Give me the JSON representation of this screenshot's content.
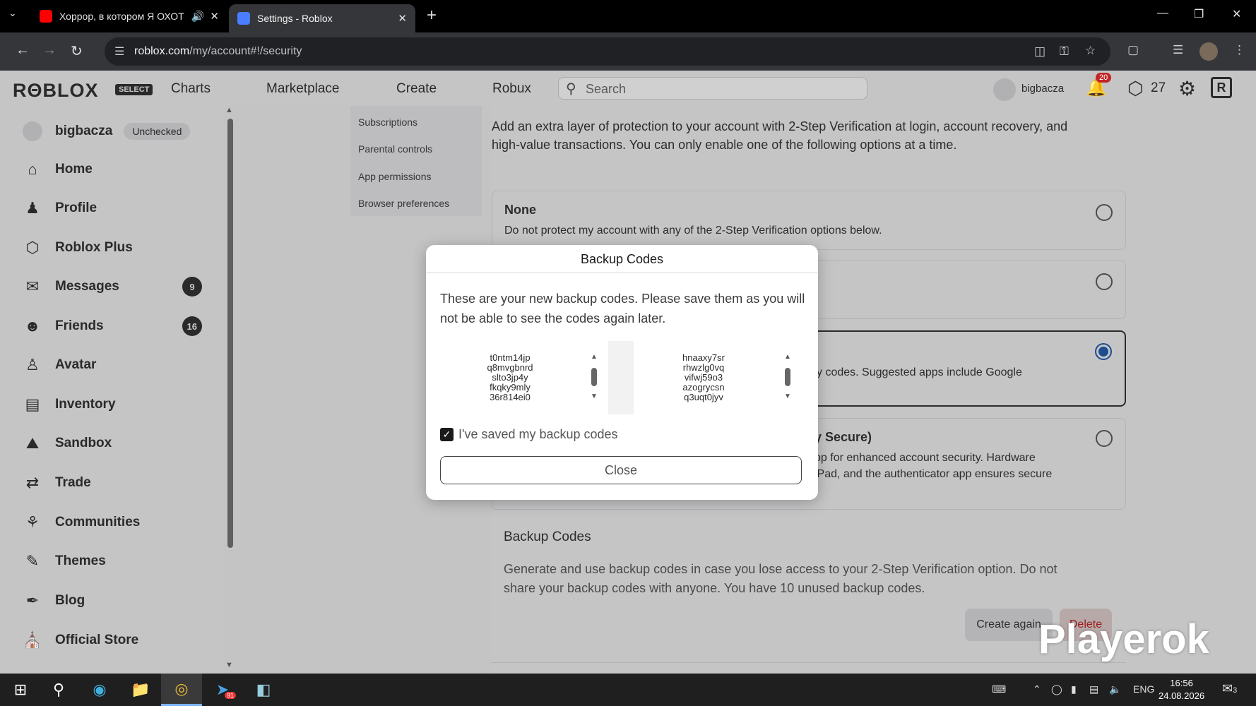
{
  "browser": {
    "tabs": [
      {
        "title": "Хоррор, в котором Я ОХОТ",
        "icon": "youtube-icon",
        "color": "#ff0000"
      },
      {
        "title": "Settings - Roblox",
        "icon": "roblox-icon",
        "color": "#4a7dff"
      }
    ],
    "url_host": "roblox.com",
    "url_path": "/my/account#!/security"
  },
  "roblox_header": {
    "logo": "RΘBLOX",
    "logo_badge": "SELECT",
    "nav": [
      "Charts",
      "Marketplace",
      "Create",
      "Robux"
    ],
    "search_placeholder": "Search",
    "username": "bigbacza",
    "notifications": "20",
    "robux": "27"
  },
  "sidebar": {
    "username": "bigbacza",
    "status": "Unchecked",
    "items": [
      {
        "label": "Home",
        "icon": "home-icon",
        "badge": ""
      },
      {
        "label": "Profile",
        "icon": "profile-icon",
        "badge": ""
      },
      {
        "label": "Roblox Plus",
        "icon": "roblox-plus-icon",
        "badge": ""
      },
      {
        "label": "Messages",
        "icon": "messages-icon",
        "badge": "9"
      },
      {
        "label": "Friends",
        "icon": "friends-icon",
        "badge": "16"
      },
      {
        "label": "Avatar",
        "icon": "avatar-icon",
        "badge": ""
      },
      {
        "label": "Inventory",
        "icon": "inventory-icon",
        "badge": ""
      },
      {
        "label": "Sandbox",
        "icon": "sandbox-icon",
        "badge": ""
      },
      {
        "label": "Trade",
        "icon": "trade-icon",
        "badge": ""
      },
      {
        "label": "Communities",
        "icon": "communities-icon",
        "badge": ""
      },
      {
        "label": "Themes",
        "icon": "themes-icon",
        "badge": ""
      },
      {
        "label": "Blog",
        "icon": "blog-icon",
        "badge": ""
      },
      {
        "label": "Official Store",
        "icon": "store-icon",
        "badge": ""
      }
    ]
  },
  "settings_menu": [
    "Subscriptions",
    "Parental controls",
    "App permissions",
    "Browser preferences"
  ],
  "security": {
    "intro": "Add an extra layer of protection to your account with 2-Step Verification at login, account recovery, and high-value transactions. You can only enable one of the following options at a time.",
    "options": [
      {
        "title": "None",
        "desc": "Do not protect my account with any of the 2-Step Verification options below.",
        "selected": false
      },
      {
        "title": "",
        "desc": "",
        "selected": false
      },
      {
        "title": "",
        "desc": "y codes. Suggested apps include Google",
        "selected": true
      },
      {
        "title": "y Secure)",
        "desc": "pp for enhanced account security. Hardware\niPad, and the authenticator app ensures secure",
        "selected": false
      }
    ],
    "backup_title": "Backup Codes",
    "backup_desc": "Generate and use backup codes in case you lose access to your 2-Step Verification option. Do not share your backup codes with anyone. You have 10 unused backup codes.",
    "create_again": "Create again",
    "delete": "Delete"
  },
  "modal": {
    "title": "Backup Codes",
    "text": "These are your new backup codes. Please save them as you will not be able to see the codes again later.",
    "codes_left": [
      "t0ntm14jp",
      "q8mvgbnrd",
      "slto3jp4y",
      "fkqky9mly",
      "36r814ei0"
    ],
    "codes_right": [
      "hnaaxy7sr",
      "rhwzlg0vq",
      "vifwj59o3",
      "azogrycsn",
      "q3uqt0jyv"
    ],
    "checkbox_label": "I've saved my backup codes",
    "checked": true,
    "close": "Close"
  },
  "watermark": "Playerok",
  "taskbar": {
    "lang": "ENG",
    "time": "16:56",
    "date": "24.08.2026",
    "notif_count": "3",
    "telegram_badge": "91"
  }
}
